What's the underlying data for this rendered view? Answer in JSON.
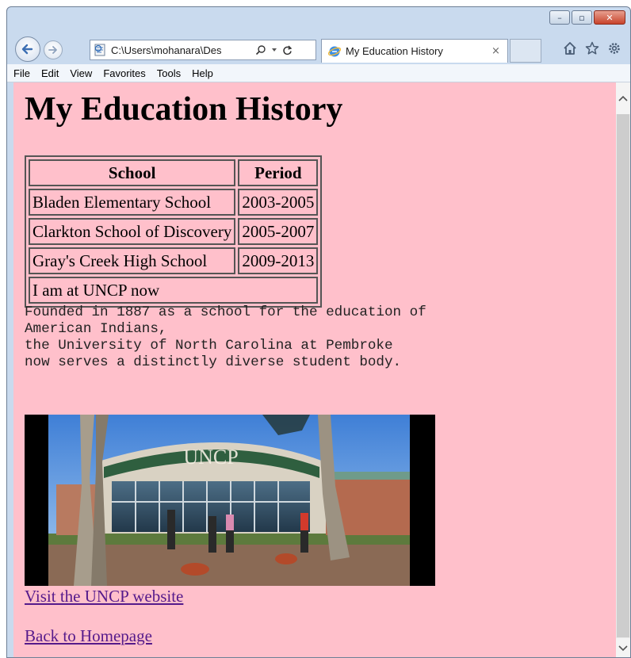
{
  "browser": {
    "address": "C:\\Users\\mohanara\\Des",
    "tab_title": "My Education History",
    "tab_close": "×",
    "menu": [
      "File",
      "Edit",
      "View",
      "Favorites",
      "Tools",
      "Help"
    ],
    "caption_buttons": {
      "minimize": "–",
      "maximize": "▫",
      "close": "✕"
    },
    "toolbar_icons": [
      "home-icon",
      "star-icon",
      "gear-icon"
    ]
  },
  "page": {
    "heading": "My Education History",
    "table": {
      "headers": [
        "School",
        "Period"
      ],
      "rows": [
        [
          "Bladen Elementary School",
          "2003-2005"
        ],
        [
          "Clarkton School of Discovery",
          "2005-2007"
        ],
        [
          "Gray's Creek High School",
          "2009-2013"
        ]
      ],
      "footer": "I am at UNCP now"
    },
    "blurb_lines": [
      "Founded in 1887 as a school for the education of",
      "American Indians,",
      "the University of North Carolina at Pembroke",
      "now serves a distinctly diverse student body."
    ],
    "photo_sign": "UNCP",
    "links": {
      "website": "Visit the UNCP website",
      "home": "Back to Homepage"
    }
  },
  "colors": {
    "page_background": "#ffc0cb",
    "visited_link": "#551a8b",
    "chrome": "#c9daee"
  }
}
